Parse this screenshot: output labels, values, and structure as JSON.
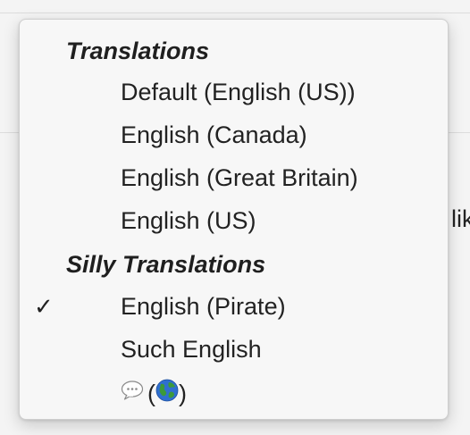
{
  "background": {
    "peek_text": "lik"
  },
  "menu": {
    "sections": [
      {
        "header": "Translations",
        "items": [
          "Default (English (US))",
          "English (Canada)",
          "English (Great Britain)",
          "English (US)"
        ]
      },
      {
        "header": "Silly Translations",
        "items": [
          "English (Pirate)",
          "Such English"
        ],
        "emoji_item": {
          "open_paren": "(",
          "close_paren": ")",
          "icons": [
            "speech-bubble-icon",
            "globe-icon"
          ]
        }
      }
    ],
    "checked_item": "English (Pirate)",
    "check_glyph": "✓"
  },
  "colors": {
    "menu_bg": "#f7f7f7",
    "text": "#222222",
    "globe_water": "#2f6fd0",
    "globe_land": "#3c9a3a"
  }
}
